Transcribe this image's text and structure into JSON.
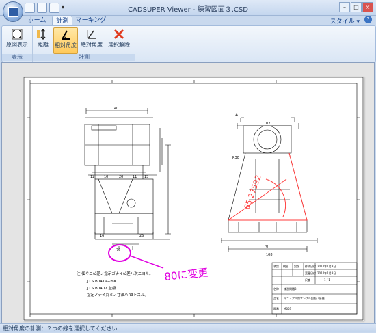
{
  "window": {
    "title": "CADSUPER Viewer - 練習図面３.CSD"
  },
  "tabs": [
    {
      "label": "ホーム"
    },
    {
      "label": "計測"
    },
    {
      "label": "マーキング"
    }
  ],
  "style_menu": "スタイル",
  "ribbon": {
    "groups": [
      {
        "label": "表示"
      },
      {
        "label": "計測"
      }
    ],
    "buttons": [
      {
        "label": "原図表示"
      },
      {
        "label": "距離"
      },
      {
        "label": "相対角度"
      },
      {
        "label": "絶対角度"
      },
      {
        "label": "選択解除"
      }
    ]
  },
  "drawing": {
    "notes": [
      "注  個々ニ公差ノ指示ガナイ公差ハ次ニヨル。",
      "J I S  B0419−mK",
      "J I S  B0407  並級",
      "指定ノナイ丸ミノ寸法ハR3トスル。"
    ],
    "markup_text": "80に変更",
    "measure_text": "65.27592",
    "dims": {
      "d40": "40",
      "d70": "70",
      "d108": "108",
      "d102": "102",
      "d70b": "70",
      "d12": "12",
      "d10": "10",
      "d20": "20",
      "d11": "11",
      "d15": "15",
      "d16": "16",
      "d26": "26",
      "r30": "R30",
      "section_a": "A"
    },
    "titleblock": {
      "r1": [
        "承認",
        "検図",
        "設計",
        "作成日付",
        "2014年1月8日"
      ],
      "r2": [
        "変更日付",
        "2014年1月8日"
      ],
      "r3": [
        "尺度",
        "1 / 1"
      ],
      "name_label": "名称",
      "name_value": "練習問題3",
      "part_label": "品名",
      "part_value": "マニュアル用サンプル図面（台座）",
      "no_label": "図番",
      "no_value": "M003"
    }
  },
  "status": {
    "text": "相対角度の計測：２つの線を選択してください"
  }
}
